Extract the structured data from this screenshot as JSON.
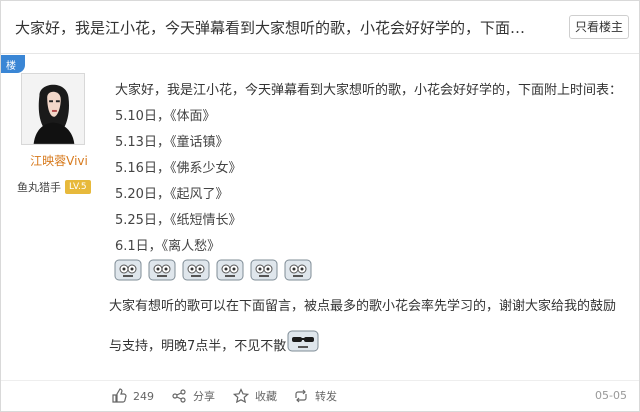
{
  "header": {
    "title": "大家好，我是江小花，今天弹幕看到大家想听的歌，小花会好好学的，下面附上...",
    "only_op_button": "只看楼主"
  },
  "post": {
    "op_ribbon": "楼主",
    "user": {
      "name": "江映蓉Vivi",
      "title": "鱼丸猎手",
      "level": "LV.5"
    },
    "lines": [
      "大家好，我是江小花，今天弹幕看到大家想听的歌，小花会好好学的，下面附上时间表：",
      "5.10日，《体面》",
      "5.13日，《童话镇》",
      "5.16日，《佛系少女》",
      "5.20日，《起风了》",
      "5.25日，《纸短情长》",
      "6.1日，《离人愁》"
    ],
    "paragraph2_line1": "大家有想听的歌可以在下面留言，被点最多的歌小花会率先学习的，谢谢大家给我的鼓励",
    "paragraph2_line2": "与支持，明晚7点半，不见不散"
  },
  "footer": {
    "like_count": "249",
    "share_label": "分享",
    "favorite_label": "收藏",
    "repost_label": "转发",
    "date": "05-05"
  }
}
